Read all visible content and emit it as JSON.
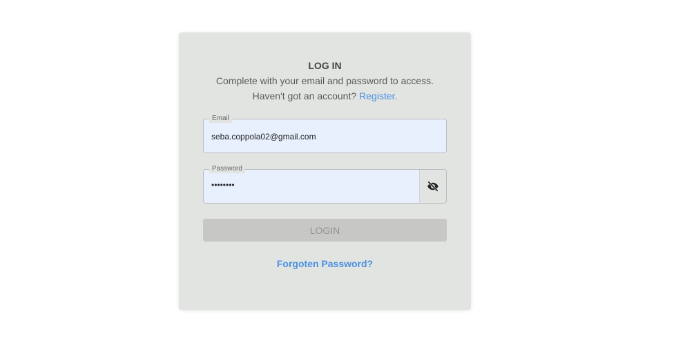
{
  "login": {
    "title": "LOG IN",
    "subtitle": "Complete with your email and password to access.",
    "no_account_text": "Haven't got an account?",
    "register_link": "Register",
    "register_dot": ".",
    "email": {
      "label": "Email",
      "value": "seba.coppola02@gmail.com"
    },
    "password": {
      "label": "Password",
      "masked_value": "••••••••",
      "visibility_icon": "eye-off-icon"
    },
    "login_button": "LOGIN",
    "forgot_password": "Forgoten Password?"
  },
  "colors": {
    "card_bg": "#e2e4e1",
    "input_bg": "#e8f0fe",
    "link": "#4a90e2",
    "button_disabled": "#c7c8c6"
  }
}
